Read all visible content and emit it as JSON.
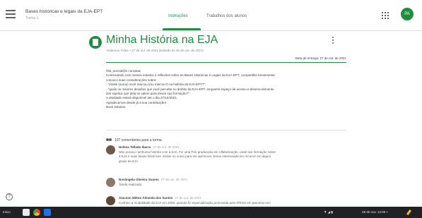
{
  "header": {
    "course_title": "Bases históricas e legais da EJA-EPT",
    "course_subtitle": "Turma 1",
    "tabs": [
      {
        "label": "Instruções",
        "active": true
      },
      {
        "label": "Trabalhos dos alunos",
        "active": false
      }
    ],
    "user_initials": "PA"
  },
  "assignment": {
    "title": "Minha História na EJA",
    "meta": "Anderson Felter • 27 de out. de 2021 (Editado às 29 de out. de 2021)",
    "due": "Data de entrega: 27 de out. de 2021",
    "body": [
      "Olá, prezad@s cursistas",
      "Continuando com nossos estudos e reflexões sobre as Bases Históricas e Legais da EJA-EPT, compartilhe brevemente",
      "conosco suas considerações sobre:",
      "- \"existe (ou/ou) você marcou (/ou marcou?) na história da EJA-EPT?\";",
      "- \"quais os maiores desafios que você percebe no âmbito da EJA-EPT, enquanto espaço de acesso e desenvolvimento",
      "dos sujeitos que dela se valem para elevar sua formação?\"",
      "A atividade estará disponível até o dia 27/10/2021.",
      "Agradecemos desde já a sua contribuição!",
      "Bons estudos."
    ]
  },
  "comments": {
    "header": "107 comentários para a turma",
    "items": [
      {
        "author": "Helena Tellado Ibarra",
        "date": "27 de out. de 2021",
        "lines": [
          "Não possuo nenhuma história com a EJA. Fiz uma Pós-graduação em Alfabetização, onde tive formação sobre",
          "a EJA e suas bases históricas. Estive no curso para me aprimorar. Estou interessada em recorrer em algum",
          "grupo da EJA."
        ]
      },
      {
        "author": "Rosângela Oliveira Soares",
        "date": "27 de out. de 2021",
        "lines": [
          "Tarefa realizada."
        ]
      },
      {
        "author": "Atacson Milton Almeida dos Santos",
        "date": "27 de out. de 2021",
        "lines": [
          "Conheci a modalidade da EJA em 2006, quando fiz especialização promovida pelo IFRGS em parceria com"
        ]
      }
    ]
  },
  "help_glyph": "?",
  "taskbar": {
    "left_label": "Início",
    "tray": "▼ ◢ ▮",
    "time": "29 de nov. 13:00 ▪"
  }
}
